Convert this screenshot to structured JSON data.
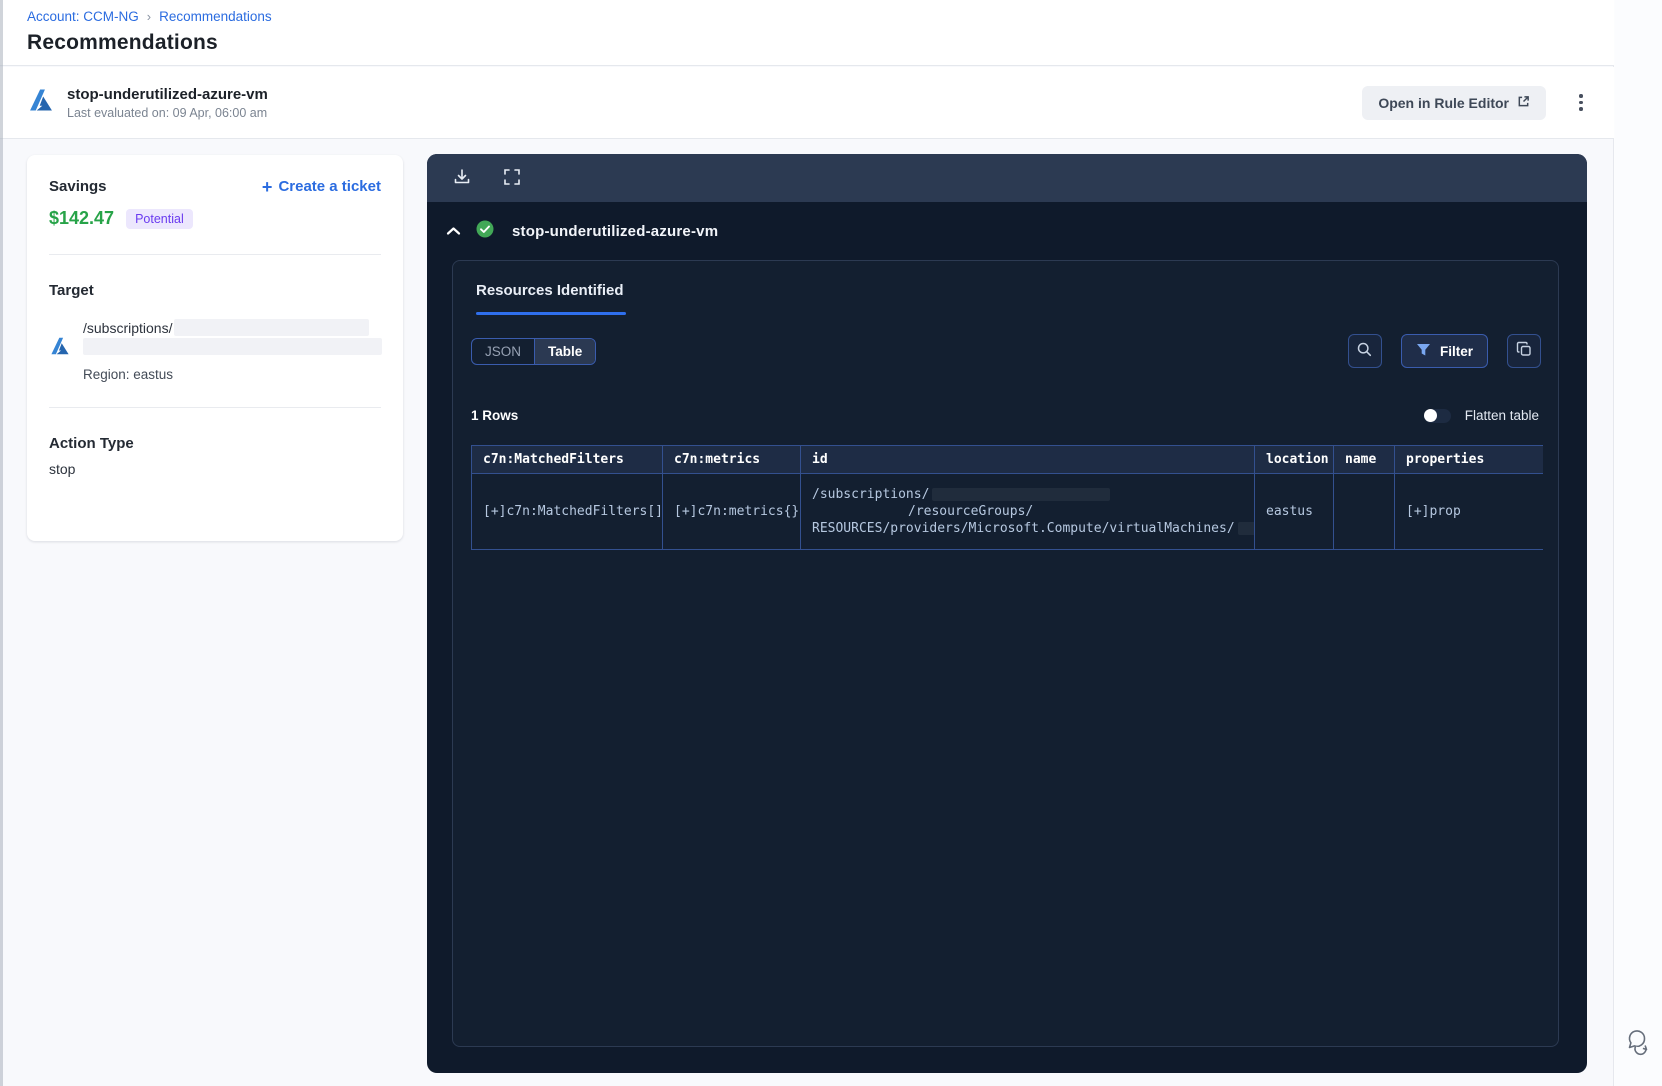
{
  "breadcrumb": {
    "account": "Account: CCM-NG",
    "separator": "›",
    "current": "Recommendations"
  },
  "page_title": "Recommendations",
  "header": {
    "rule_name": "stop-underutilized-azure-vm",
    "last_evaluated": "Last evaluated on: 09 Apr, 06:00 am",
    "open_rule_editor_label": "Open in Rule Editor"
  },
  "savings_card": {
    "savings_label": "Savings",
    "create_ticket_plus": "+",
    "create_ticket_label": "Create a ticket",
    "amount": "$142.47",
    "badge": "Potential",
    "target_label": "Target",
    "target_path": "/subscriptions/",
    "region": "Region: eastus",
    "action_type_label": "Action Type",
    "action_type_value": "stop"
  },
  "results_panel": {
    "rule_name": "stop-underutilized-azure-vm",
    "tab_label": "Resources Identified",
    "view_toggle": {
      "json_label": "JSON",
      "table_label": "Table",
      "selected": "Table"
    },
    "filter_label": "Filter",
    "rows_count": "1 Rows",
    "flatten_label": "Flatten table",
    "flatten_enabled": false,
    "table": {
      "columns": [
        "c7n:MatchedFilters",
        "c7n:metrics",
        "id",
        "location",
        "name",
        "properties"
      ],
      "row": {
        "matched_filters": "[+]c7n:MatchedFilters[]",
        "metrics": "[+]c7n:metrics{}",
        "id_line1": "/subscriptions/",
        "id_line2": "/resourceGroups/",
        "id_line3": "RESOURCES/providers/Microsoft.Compute/virtualMachines/",
        "location": "eastus",
        "name": "",
        "properties": "[+]prop"
      }
    }
  },
  "colors": {
    "accent_blue": "#2f6fed",
    "link_blue": "#2b6ce0",
    "success_green": "#42a857",
    "savings_green": "#27a348",
    "badge_purple": "#6a3bf0",
    "panel_dark": "#0f1a2b",
    "panel_toolbar": "#2c3a52",
    "table_border": "#33508f"
  }
}
